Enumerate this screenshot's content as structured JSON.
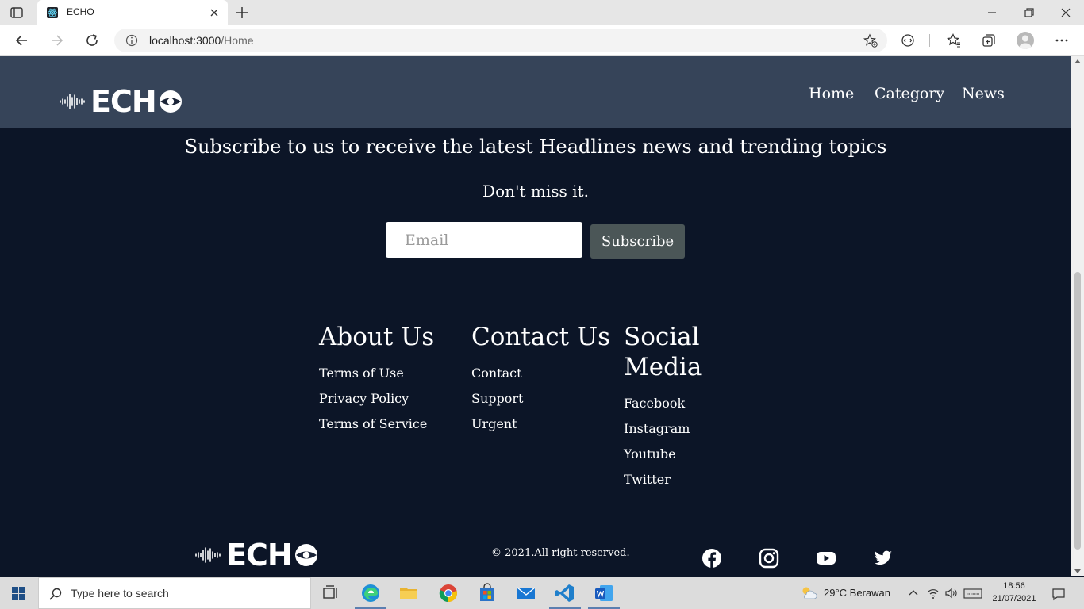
{
  "browser": {
    "tab_title": "ECHO",
    "url_host": "localhost:3000",
    "url_path": "/Home"
  },
  "header": {
    "logo_text": "ECHO",
    "nav": [
      "Home",
      "Category",
      "News"
    ]
  },
  "subscribe": {
    "headline": "Subscribe to us to receive the latest Headlines news and trending topics",
    "subheadline": "Don't miss it.",
    "email_placeholder": "Email",
    "button_label": "Subscribe"
  },
  "footer": {
    "columns": [
      {
        "title": "About Us",
        "links": [
          "Terms of Use",
          "Privacy Policy",
          "Terms of Service"
        ]
      },
      {
        "title": "Contact Us",
        "links": [
          "Contact",
          "Support",
          "Urgent"
        ]
      },
      {
        "title_line1": "Social",
        "title_line2": "Media",
        "links": [
          "Facebook",
          "Instagram",
          "Youtube",
          "Twitter"
        ]
      }
    ],
    "logo_text": "ECHO",
    "copyright": "© 2021.All right reserved.",
    "social_icons": [
      "facebook-icon",
      "instagram-icon",
      "youtube-icon",
      "twitter-icon"
    ]
  },
  "taskbar": {
    "search_placeholder": "Type here to search",
    "weather_temp": "29°C",
    "weather_desc": "Berawan",
    "time": "18:56",
    "date": "21/07/2021"
  },
  "colors": {
    "page_bg": "#0c1527",
    "header_bg": "#364459",
    "button_bg": "#4b5657"
  }
}
